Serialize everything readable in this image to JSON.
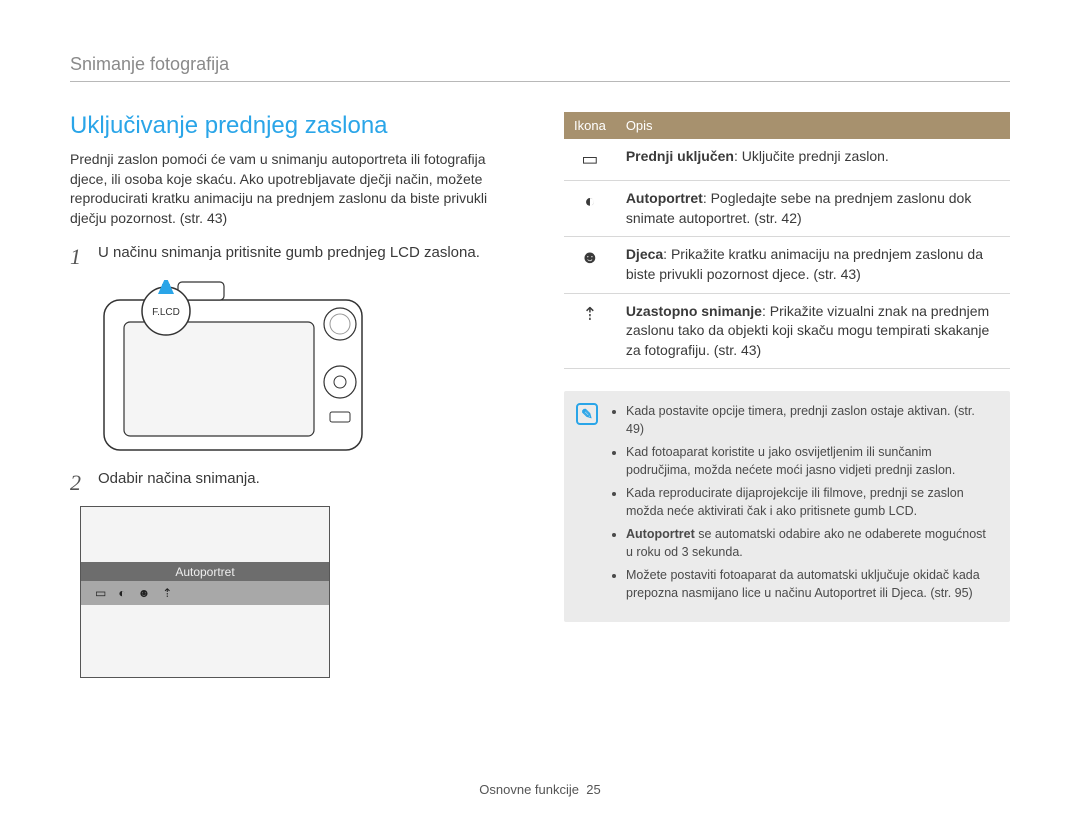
{
  "section_header": "Snimanje fotografija",
  "title": "Uključivanje prednjeg zaslona",
  "intro": "Prednji zaslon pomoći će vam u snimanju autoportreta ili fotografija djece, ili osoba koje skaću. Ako upotrebljavate dječji način, možete reproducirati kratku animaciju na prednjem zaslonu da biste privukli dječju pozornost. (str. 43)",
  "steps": {
    "1": "U načinu snimanja pritisnite gumb prednjeg LCD zaslona.",
    "2": "Odabir načina snimanja."
  },
  "camera_label": "F.LCD",
  "mode_bar_label": "Autoportret",
  "table": {
    "header": {
      "ikona": "Ikona",
      "opis": "Opis"
    },
    "rows": [
      {
        "icon": "front-on-icon",
        "bold": "Prednji uključen",
        "rest": ": Uključite prednji zaslon."
      },
      {
        "icon": "self-portrait-icon",
        "bold": "Autoportret",
        "rest": ": Pogledajte sebe na prednjem zaslonu dok snimate autoportret. (str. 42)"
      },
      {
        "icon": "children-icon",
        "bold": "Djeca",
        "rest": ": Prikažite kratku animaciju na prednjem zaslonu da biste privukli pozornost djece. (str. 43)"
      },
      {
        "icon": "jump-shot-icon",
        "bold": "Uzastopno snimanje",
        "rest": ": Prikažite vizualni znak na prednjem zaslonu tako da objekti koji skaču mogu tempirati skakanje za fotografiju. (str. 43)"
      }
    ]
  },
  "notes": [
    "Kada postavite opcije timera, prednji zaslon ostaje aktivan. (str. 49)",
    "Kad fotoaparat koristite u jako osvijetljenim ili sunčanim područjima, možda nećete moći jasno vidjeti prednji zaslon.",
    "Kada reproducirate dijaprojekcije ili filmove, prednji se zaslon možda neće aktivirati čak i ako pritisnete gumb LCD.",
    "Autoportret se automatski odabire ako ne odaberete mogućnost u roku od 3 sekunda.",
    "Možete postaviti fotoaparat da automatski uključuje okidač kada prepozna nasmijano lice u načinu Autoportret ili Djeca. (str. 95)"
  ],
  "footer": {
    "label": "Osnovne funkcije",
    "page": "25"
  }
}
